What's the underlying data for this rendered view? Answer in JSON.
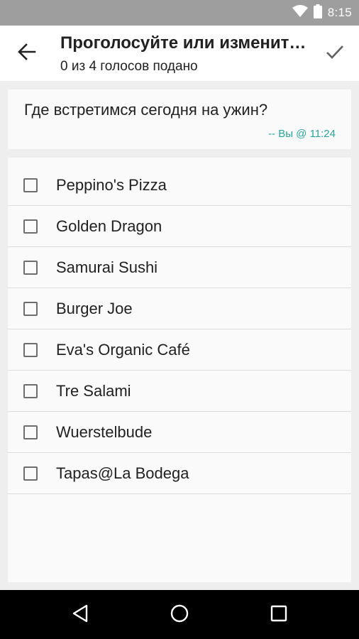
{
  "status_bar": {
    "time": "8:15",
    "icons": [
      "wifi-icon",
      "battery-icon"
    ]
  },
  "app_bar": {
    "title": "Проголосуйте или изменит…",
    "subtitle": "0 из 4 голосов подано",
    "icons": [
      "back-arrow-icon",
      "checkmark-icon"
    ]
  },
  "question": {
    "text": "Где встретимся сегодня на ужин?",
    "meta": "-- Вы @ 11:24"
  },
  "options": [
    {
      "label": "Peppino's Pizza",
      "checked": false
    },
    {
      "label": "Golden Dragon",
      "checked": false
    },
    {
      "label": "Samurai Sushi",
      "checked": false
    },
    {
      "label": "Burger Joe",
      "checked": false
    },
    {
      "label": "Eva's Organic Café",
      "checked": false
    },
    {
      "label": "Tre Salami",
      "checked": false
    },
    {
      "label": "Wuerstelbude",
      "checked": false
    },
    {
      "label": "Tapas@La Bodega",
      "checked": false
    }
  ],
  "nav_bar": {
    "icons": [
      "back-triangle-icon",
      "home-circle-icon",
      "recents-square-icon"
    ]
  },
  "colors": {
    "status_bar": "#9e9e9e",
    "accent": "#26a69a",
    "background": "#eeeeee"
  }
}
